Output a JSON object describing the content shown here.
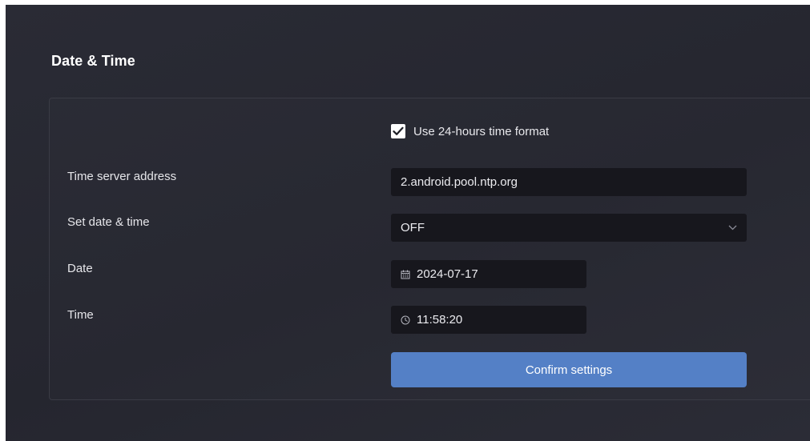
{
  "section": {
    "title": "Date & Time"
  },
  "settings": {
    "use_24h": {
      "label": "Use 24-hours time format",
      "checked": true
    },
    "time_server": {
      "label": "Time server address",
      "value": "2.android.pool.ntp.org"
    },
    "set_date_time": {
      "label": "Set date & time",
      "value": "OFF"
    },
    "date": {
      "label": "Date",
      "value": "2024-07-17",
      "icon": "calendar-icon"
    },
    "time": {
      "label": "Time",
      "value": "11:58:20",
      "icon": "clock-icon"
    }
  },
  "actions": {
    "confirm_label": "Confirm settings"
  },
  "colors": {
    "background": "#27282f",
    "field": "#17171d",
    "accent": "#5480c6"
  }
}
